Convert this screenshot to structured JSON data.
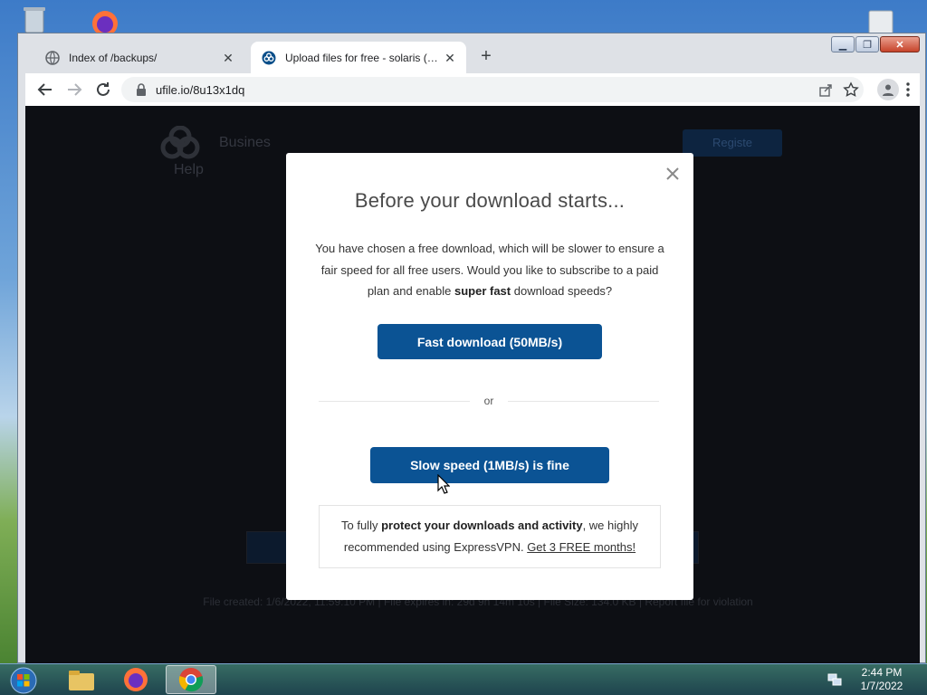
{
  "browser": {
    "tabs": [
      {
        "title": "Index of /backups/",
        "active": false
      },
      {
        "title": "Upload files for free - solaris (1).c",
        "active": true
      }
    ],
    "address_url": "ufile.io/8u13x1dq"
  },
  "background_page": {
    "logo_word": "Busines",
    "help_label": "Help",
    "register_label": "Registe",
    "footer_text": "File created: 1/6/2022, 11:59:10 PM   |   File expires in: 29d 9h 14m 10s   |   File Size: 134.0 KB   |   Report file for violation"
  },
  "modal": {
    "title": "Before your download starts...",
    "text_part1": "You have chosen a free download, which will be slower to ensure a fair speed for all free users. Would you like to subscribe to a paid plan and enable ",
    "text_bold": "super fast",
    "text_part2": " download speeds?",
    "fast_button": "Fast download (50MB/s)",
    "or_label": "or",
    "slow_button": "Slow speed (1MB/s) is fine",
    "vpn_part1": "To fully ",
    "vpn_bold": "protect your downloads and activity",
    "vpn_part2": ", we highly recommended using ExpressVPN. ",
    "vpn_link": "Get 3 FREE months!"
  },
  "taskbar": {
    "time": "2:44 PM",
    "date": "1/7/2022"
  },
  "colors": {
    "primary_button": "#0b5394",
    "page_overlay": "#0d0f14"
  }
}
